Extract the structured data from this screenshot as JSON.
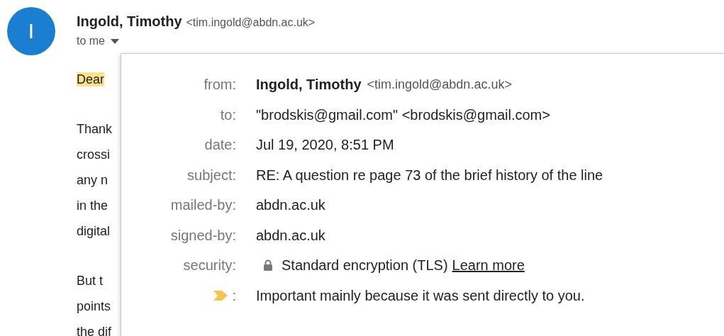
{
  "sender": {
    "initial": "I",
    "name": "Ingold, Timothy",
    "email": "<tim.ingold@abdn.ac.uk>"
  },
  "recipient": "to me",
  "body": [
    [
      {
        "text": "Dear",
        "highlighted": true
      }
    ],
    [
      {
        "text": "Thank",
        "highlighted": false
      },
      {
        "text": "crossi",
        "highlighted": false
      },
      {
        "text": "any n",
        "highlighted": false
      },
      {
        "text": "in the",
        "highlighted": false
      },
      {
        "text": "digital",
        "highlighted": false
      }
    ],
    [
      {
        "text": "But t",
        "highlighted": false
      },
      {
        "text": "points",
        "highlighted": false
      },
      {
        "text": "the dif",
        "highlighted": false
      }
    ]
  ],
  "details": [
    {
      "kind": "sender",
      "label": "from:",
      "name": "Ingold, Timothy",
      "email": "<tim.ingold@abdn.ac.uk>"
    },
    {
      "kind": "text",
      "label": "to:",
      "value": "\"brodskis@gmail.com\" <brodskis@gmail.com>"
    },
    {
      "kind": "text",
      "label": "date:",
      "value": "Jul 19, 2020, 8:51 PM"
    },
    {
      "kind": "text",
      "label": "subject:",
      "value": "RE: A question re page 73 of the brief history of the line"
    },
    {
      "kind": "text",
      "label": "mailed-by:",
      "value": "abdn.ac.uk"
    },
    {
      "kind": "text",
      "label": "signed-by:",
      "value": "abdn.ac.uk"
    },
    {
      "kind": "security",
      "label": "security:",
      "value": "Standard encryption (TLS)",
      "link": "Learn more"
    },
    {
      "kind": "importance",
      "label": ":",
      "value": "Important mainly because it was sent directly to you."
    }
  ]
}
